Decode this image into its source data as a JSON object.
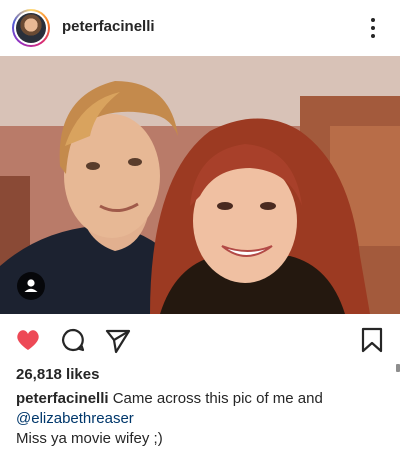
{
  "post": {
    "username": "peterfacinelli",
    "likes": "26,818 likes",
    "caption": {
      "username": "peterfacinelli",
      "text": "Came across this pic of me and",
      "mention": "@elizabethreaser",
      "line2": "Miss ya movie wifey ;)"
    }
  },
  "icons": {
    "like": "heart-icon",
    "comment": "comment-icon",
    "share": "send-icon",
    "save": "bookmark-icon",
    "more": "more-icon",
    "tag": "person-icon"
  },
  "colors": {
    "liked_heart": "#ed4956",
    "mention": "#00376b",
    "text": "#262626"
  }
}
